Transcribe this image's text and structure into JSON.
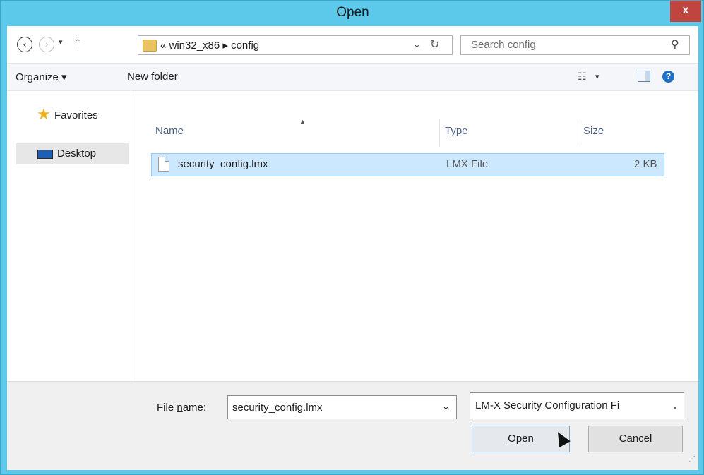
{
  "window": {
    "title": "Open",
    "close_label": "x"
  },
  "nav": {
    "back_icon": "‹",
    "forward_icon": "›",
    "dropdown_icon": "▾",
    "up_icon": "↑",
    "address_path": "« win32_x86 ▸ config",
    "address_chevron": "⌄",
    "refresh_icon": "↻",
    "search_placeholder": "Search config",
    "search_icon": "⚲"
  },
  "toolbar": {
    "organize_label": "Organize ▾",
    "new_folder_label": "New folder",
    "view_icon": "☷",
    "view_dropdown": "▾",
    "help_icon": "?"
  },
  "sidebar": {
    "items": [
      {
        "label": "Favorites",
        "icon": "star-icon"
      },
      {
        "label": "Desktop",
        "icon": "desktop-icon"
      }
    ]
  },
  "list": {
    "sort_indicator": "▲",
    "columns": [
      "Name",
      "Type",
      "Size"
    ],
    "rows": [
      {
        "name": "security_config.lmx",
        "type": "LMX File",
        "size": "2 KB"
      }
    ]
  },
  "bottom": {
    "file_name_label_pre": "File ",
    "file_name_label_mnemonic": "n",
    "file_name_label_post": "ame:",
    "file_name_value": "security_config.lmx",
    "file_name_chevron": "⌄",
    "file_type_value": "LM-X Security Configuration Fi",
    "file_type_chevron": "⌄",
    "open_mnemonic": "O",
    "open_rest": "pen",
    "cancel_label": "Cancel"
  },
  "colors": {
    "title_bar": "#5cc9ea",
    "close_button": "#c0453f",
    "selection": "#cce8ff"
  }
}
